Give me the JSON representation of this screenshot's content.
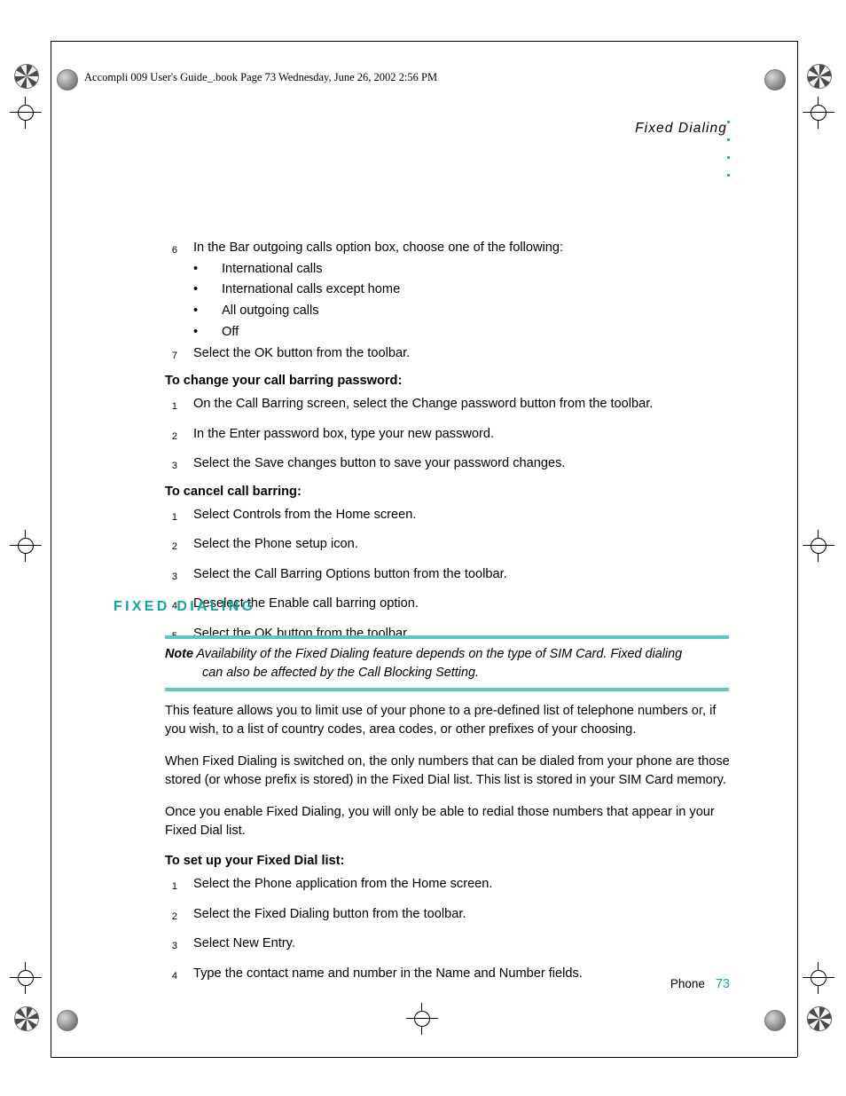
{
  "header": {
    "booktext": "Accompli 009 User's Guide_.book  Page 73  Wednesday, June 26, 2002  2:56 PM",
    "chapter_title": "Fixed Dialing"
  },
  "steps_top": [
    {
      "num": "6",
      "text": "In the Bar outgoing calls option box, choose one of the following:"
    }
  ],
  "sub_bullets": [
    {
      "bullet": "•",
      "text": "International calls"
    },
    {
      "bullet": "•",
      "text": "International calls except home"
    },
    {
      "bullet": "•",
      "text": "All outgoing calls"
    },
    {
      "bullet": "•",
      "text": "Off"
    }
  ],
  "steps_top2": [
    {
      "num": "7",
      "text": "Select the OK button from the toolbar."
    }
  ],
  "section_password": {
    "heading": "To change your call barring password:",
    "steps": [
      {
        "num": "1",
        "text": "On the Call Barring screen, select the Change password button from the toolbar."
      },
      {
        "num": "2",
        "text": "In the Enter password box, type your new password."
      },
      {
        "num": "3",
        "text": "Select the Save changes button to save your password changes."
      }
    ]
  },
  "section_cancel": {
    "heading": "To cancel call barring:",
    "steps": [
      {
        "num": "1",
        "text": "Select Controls from the Home screen."
      },
      {
        "num": "2",
        "text": "Select the Phone setup icon."
      },
      {
        "num": "3",
        "text": "Select the Call Barring Options button from the toolbar."
      },
      {
        "num": "4",
        "text": "Deselect the Enable call barring option."
      },
      {
        "num": "5",
        "text": "Select the OK button from the toolbar."
      }
    ]
  },
  "section_title": "FIXED DIALING",
  "note": {
    "label": "Note",
    "line1": " Availability of the Fixed Dialing feature depends on the type of SIM Card. Fixed dialing",
    "line2": "can also be affected by the Call Blocking Setting."
  },
  "paragraphs": [
    "This feature allows you to limit use of your phone to a pre-defined list of telephone numbers or, if you wish, to a list of country codes, area codes, or other prefixes of your choosing.",
    "When Fixed Dialing is switched on, the only numbers that can be dialed from your phone are those stored (or whose prefix is stored) in the Fixed Dial list. This list is stored in your SIM Card memory.",
    "Once you enable Fixed Dialing, you will only be able to redial those numbers that appear in your Fixed Dial list."
  ],
  "section_fixeddial": {
    "heading": "To set up your Fixed Dial list:",
    "steps": [
      {
        "num": "1",
        "text": "Select the Phone application from the Home screen."
      },
      {
        "num": "2",
        "text": "Select the Fixed Dialing button from the toolbar."
      },
      {
        "num": "3",
        "text": "Select New Entry."
      },
      {
        "num": "4",
        "text": "Type the contact name and number in the Name and Number fields."
      }
    ]
  },
  "footer": {
    "label": "Phone",
    "page": "73"
  },
  "colors": {
    "accent": "#12a699",
    "note_rule": "#5ec8bd",
    "dot": "#22b3a6"
  }
}
